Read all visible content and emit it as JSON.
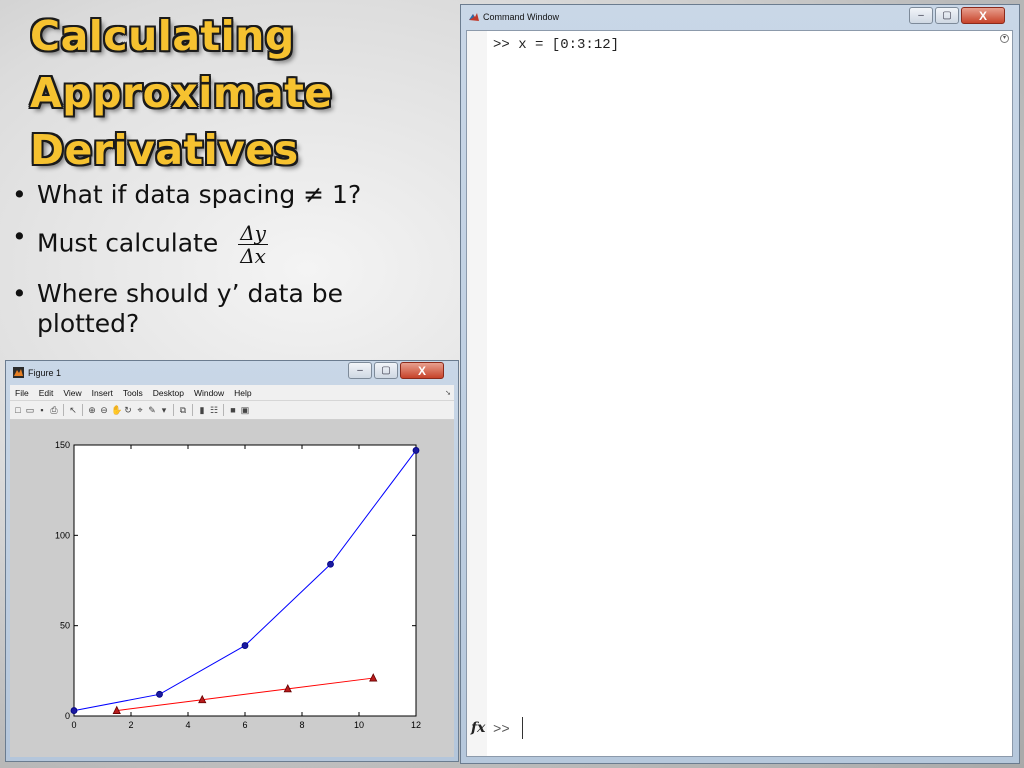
{
  "slide": {
    "title_lines": [
      "Calculating",
      "Approximate",
      "Derivatives"
    ],
    "bullets": [
      {
        "text": "What if data spacing ≠ 1?"
      },
      {
        "text": "Must calculate",
        "fraction": {
          "numerator": "Δy",
          "denominator": "Δx"
        }
      },
      {
        "text": "Where should y’ data be plotted?"
      }
    ],
    "bullet_symbol": "•"
  },
  "command_window": {
    "title": "Command Window",
    "history_line": ">> x = [0:3:12]",
    "prompt": ">>",
    "fx_label": "fx",
    "options_glyph": "▾",
    "buttons": {
      "minimize": "–",
      "maximize": "▢",
      "close": "X"
    }
  },
  "figure_window": {
    "title": "Figure 1",
    "menu": [
      "File",
      "Edit",
      "View",
      "Insert",
      "Tools",
      "Desktop",
      "Window",
      "Help"
    ],
    "menu_arrow": "➘",
    "buttons": {
      "minimize": "–",
      "maximize": "▢",
      "close": "X"
    },
    "toolbar": [
      {
        "name": "new-figure-icon",
        "glyph": "□"
      },
      {
        "name": "open-file-icon",
        "glyph": "▭"
      },
      {
        "name": "save-icon",
        "glyph": "▪"
      },
      {
        "name": "print-icon",
        "glyph": "⎙"
      },
      {
        "sep": true
      },
      {
        "name": "edit-plot-arrow-icon",
        "glyph": "↖"
      },
      {
        "sep": true
      },
      {
        "name": "zoom-in-icon",
        "glyph": "⊕"
      },
      {
        "name": "zoom-out-icon",
        "glyph": "⊖"
      },
      {
        "name": "pan-hand-icon",
        "glyph": "✋"
      },
      {
        "name": "rotate-3d-icon",
        "glyph": "↻"
      },
      {
        "name": "data-cursor-icon",
        "glyph": "⌖"
      },
      {
        "name": "brush-icon",
        "glyph": "✎"
      },
      {
        "name": "brush-dropdown-icon",
        "glyph": "▾"
      },
      {
        "sep": true
      },
      {
        "name": "link-plot-icon",
        "glyph": "⧉"
      },
      {
        "sep": true
      },
      {
        "name": "insert-colorbar-icon",
        "glyph": "▮"
      },
      {
        "name": "insert-legend-icon",
        "glyph": "☷"
      },
      {
        "sep": true
      },
      {
        "name": "hide-plot-tools-icon",
        "glyph": "■"
      },
      {
        "name": "show-plot-tools-icon",
        "glyph": "▣"
      }
    ]
  },
  "chart_data": {
    "type": "line",
    "title": "",
    "xlabel": "",
    "ylabel": "",
    "xlim": [
      0,
      12
    ],
    "ylim": [
      0,
      150
    ],
    "xticks": [
      0,
      2,
      4,
      6,
      8,
      10,
      12
    ],
    "yticks": [
      0,
      50,
      100,
      150
    ],
    "grid": false,
    "series": [
      {
        "x": [
          0,
          3,
          6,
          9,
          12
        ],
        "y": [
          3,
          12,
          39,
          84,
          147
        ],
        "color": "#0000ff",
        "marker": "circle",
        "marker_fill": "#1a1aa0"
      },
      {
        "x": [
          1.5,
          4.5,
          7.5,
          10.5
        ],
        "y": [
          3,
          9,
          15,
          21
        ],
        "color": "#ff0000",
        "marker": "triangle",
        "marker_fill": "#b81c1c"
      }
    ]
  }
}
